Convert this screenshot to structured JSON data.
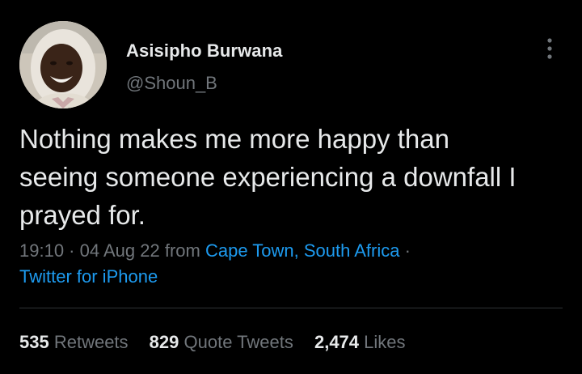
{
  "author": {
    "display_name": "Asisipho Burwana",
    "handle": "@Shoun_B",
    "avatar": "user-avatar-photo"
  },
  "tweet": {
    "text": "Nothing makes me more happy than\nseeing someone experiencing a downfall I\nprayed for.",
    "time": "19:10",
    "separator": " · ",
    "date": "04 Aug 22",
    "from_label": " from ",
    "location": "Cape Town, South Africa",
    "trailing_separator": " ·",
    "source": "Twitter for iPhone"
  },
  "stats": {
    "retweets_count": "535",
    "retweets_label": " Retweets",
    "quotes_count": "829",
    "quotes_label": " Quote Tweets",
    "likes_count": "2,474",
    "likes_label": " Likes"
  },
  "icons": {
    "more": "more-vertical-icon"
  },
  "colors": {
    "background": "#000000",
    "primary_text": "#e7e9ea",
    "secondary_text": "#71767b",
    "link": "#1d9bf0",
    "divider": "#2f3336"
  }
}
